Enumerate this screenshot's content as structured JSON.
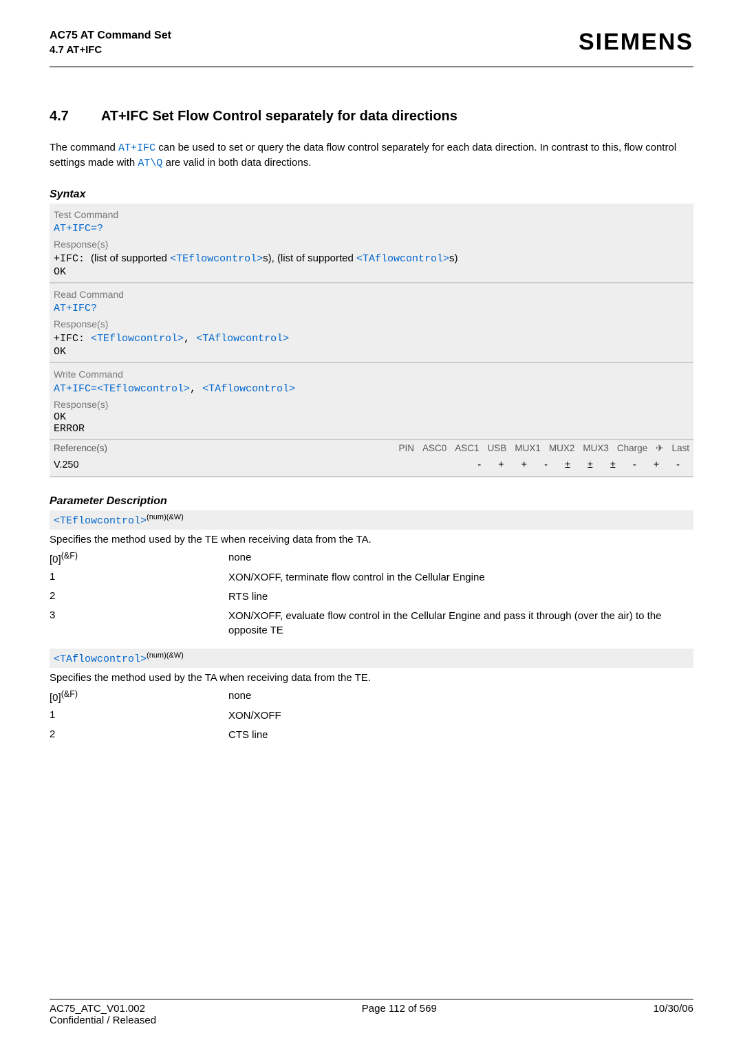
{
  "header": {
    "title": "AC75 AT Command Set",
    "subtitle": "4.7 AT+IFC",
    "brand": "SIEMENS"
  },
  "section": {
    "number": "4.7",
    "title": "AT+IFC   Set Flow Control separately for data directions"
  },
  "intro": {
    "p1a": "The command ",
    "cmd1": "AT+IFC",
    "p1b": " can be used to set or query the data flow control separately for each data direction. In contrast to this, flow control settings made with ",
    "cmd2": "AT\\Q",
    "p1c": " are valid in both data directions."
  },
  "syntax_label": "Syntax",
  "test": {
    "label": "Test Command",
    "cmd": "AT+IFC=?",
    "resp_label": "Response(s)",
    "resp_prefix": "+IFC: ",
    "resp_t1": "(list of supported ",
    "p1": "<TEflowcontrol>",
    "resp_t2": "s), (list of supported ",
    "p2": "<TAflowcontrol>",
    "resp_t3": "s)",
    "ok": "OK"
  },
  "read": {
    "label": "Read Command",
    "cmd": "AT+IFC?",
    "resp_label": "Response(s)",
    "resp_prefix": "+IFC: ",
    "p1": "<TEflowcontrol>",
    "comma": ", ",
    "p2": "<TAflowcontrol>",
    "ok": "OK"
  },
  "write": {
    "label": "Write Command",
    "cmd_prefix": "AT+IFC=",
    "p1": "<TEflowcontrol>",
    "comma": ", ",
    "p2": "<TAflowcontrol>",
    "resp_label": "Response(s)",
    "ok": "OK",
    "error": "ERROR"
  },
  "ref": {
    "label": "Reference(s)",
    "cols": [
      "PIN",
      "ASC0",
      "ASC1",
      "USB",
      "MUX1",
      "MUX2",
      "MUX3",
      "Charge",
      "✈",
      "Last"
    ],
    "name": "V.250",
    "vals": [
      "-",
      "+",
      "+",
      "-",
      "±",
      "±",
      "±",
      "-",
      "+",
      "-"
    ]
  },
  "param_label": "Parameter Description",
  "te": {
    "name": "<TEflowcontrol>",
    "sup": "(num)(&W)",
    "desc": "Specifies the method used by the TE when receiving data from the TA.",
    "rows": [
      {
        "k": "[0]",
        "ksup": "(&F)",
        "v": "none"
      },
      {
        "k": "1",
        "ksup": "",
        "v": "XON/XOFF, terminate flow control in the Cellular Engine"
      },
      {
        "k": "2",
        "ksup": "",
        "v": "RTS line"
      },
      {
        "k": "3",
        "ksup": "",
        "v": "XON/XOFF, evaluate flow control in the Cellular Engine and pass it through (over the air) to the opposite TE"
      }
    ]
  },
  "ta": {
    "name": "<TAflowcontrol>",
    "sup": "(num)(&W)",
    "desc": "Specifies the method used by the TA when receiving data from the TE.",
    "rows": [
      {
        "k": "[0]",
        "ksup": "(&F)",
        "v": "none"
      },
      {
        "k": "1",
        "ksup": "",
        "v": "XON/XOFF"
      },
      {
        "k": "2",
        "ksup": "",
        "v": "CTS line"
      }
    ]
  },
  "footer": {
    "left1": "AC75_ATC_V01.002",
    "left2": "Confidential / Released",
    "center": "Page 112 of 569",
    "right": "10/30/06"
  }
}
